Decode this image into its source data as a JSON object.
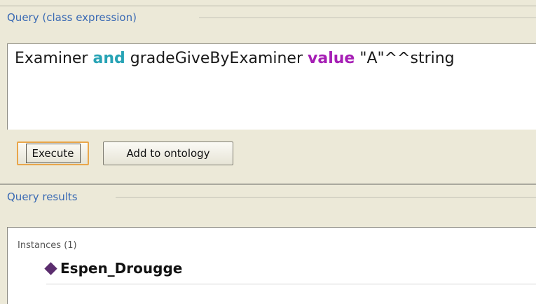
{
  "query": {
    "legend": "Query (class expression)",
    "expression": {
      "part1": "Examiner ",
      "kw_and": "and",
      "part2": " gradeGiveByExaminer ",
      "kw_value": "value",
      "part3": " \"A\"^^string"
    },
    "execute_label": "Execute",
    "add_label": "Add to ontology"
  },
  "results": {
    "legend": "Query results",
    "instances_label": "Instances (1)",
    "items": [
      {
        "name": "Espen_Drougge",
        "icon": "individual-diamond-icon"
      }
    ]
  },
  "colors": {
    "legend_blue": "#3a6ab4",
    "keyword_and": "#27a3b5",
    "keyword_value": "#a61fb5",
    "individual_diamond": "#5b2d6e",
    "focus_orange": "#e9a64a"
  }
}
